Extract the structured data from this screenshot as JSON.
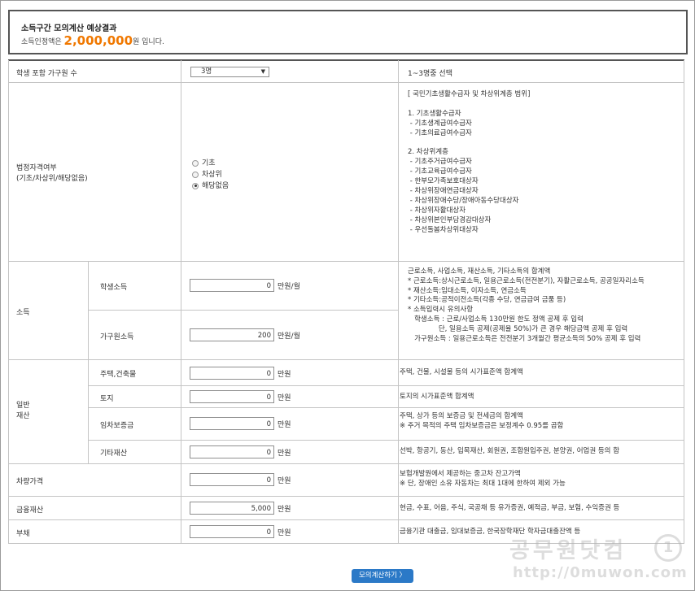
{
  "result": {
    "title": "소득구간 모의계산 예상결과",
    "prefix": "소득인정액은 ",
    "amount": "2,000,000",
    "suffix": "원 입니다."
  },
  "household": {
    "label": "학생 포함 가구원 수",
    "selected": "3명",
    "note": "1~3명중 선택"
  },
  "legal_status": {
    "label": "법정자격여부\n(기초/차상위/해당없음)",
    "options": [
      "기초",
      "차상위",
      "해당없음"
    ],
    "selected_index": 2,
    "note": "[ 국민기초생활수급자 및 차상위계층 범위]\n\n1. 기초생활수급자\n - 기초생계급여수급자\n - 기초의료급여수급자\n\n2. 차상위계층\n - 기초주거급여수급자\n - 기초교육급여수급자\n - 한부모가족보호대상자\n - 차상위장애연금대상자\n - 차상위장애수당/장애아동수당대상자\n - 차상위자활대상자\n - 차상위본인부담경감대상자\n - 우선돌봄차상위대상자"
  },
  "income": {
    "label": "소득",
    "student_label": "학생소득",
    "student_value": "0",
    "family_label": "가구원소득",
    "family_value": "200",
    "unit": "만원/월",
    "note": "근로소득, 사업소득, 재산소득, 기타소득의 합계액\n* 근로소득:상시근로소득, 일용근로소득(전전분기), 자활근로소득, 공공일자리소득\n* 재산소득:임대소득, 이자소득, 연금소득\n* 기타소득:공적이전소득(각종 수당, 연금급여 금품 등)\n* 소득입력시 유의사항\n   학생소득 : 근로/사업소득 130만원 한도 정액 공제 후 입력\n              단, 일용소득 공제(공제율 50%)가 큰 경우 해당금액 공제 후 입력\n   가구원소득 : 일용근로소득은 전전분기 3개월간 평균소득의 50% 공제 후 입력"
  },
  "general_property": {
    "label": "일반\n재산",
    "items": [
      {
        "label": "주택,건축물",
        "value": "0",
        "unit": "만원",
        "note": "주택, 건물, 시설물 등의 시가표준액 합계액"
      },
      {
        "label": "토지",
        "value": "0",
        "unit": "만원",
        "note": "토지의 시가표준액 합계액"
      },
      {
        "label": "임차보증금",
        "value": "0",
        "unit": "만원",
        "note": "주택, 상가 등의 보증금 및 전세금의 합계액\n※ 주거 목적의 주택 임차보증금은 보정계수 0.95를 곱함"
      },
      {
        "label": "기타재산",
        "value": "0",
        "unit": "만원",
        "note": "선박, 항공기, 동산, 입목재산, 회원권, 조합원입주권, 분양권, 어업권 등의 합"
      }
    ]
  },
  "vehicle": {
    "label": "차량가격",
    "value": "0",
    "unit": "만원",
    "note": "보험개발원에서 제공하는 중고차 잔고가액\n※ 단, 장애인 소유 자동차는 최대 1대에 한하여 제외 가능"
  },
  "financial": {
    "label": "금융재산",
    "value": "5,000",
    "unit": "만원",
    "note": "현금, 수표, 어음, 주식, 국공채 등 유가증권, 예적금, 부금, 보험, 수익증권 등"
  },
  "debt": {
    "label": "부채",
    "value": "0",
    "unit": "만원",
    "note": "금융기관 대출금, 임대보증금, 한국장학재단 학자금대출잔액 등"
  },
  "button_label": "모의계산하기  〉",
  "watermark": {
    "line1": "공무원닷컴",
    "line2": "http://0muwon.com",
    "logo_char": "1"
  }
}
